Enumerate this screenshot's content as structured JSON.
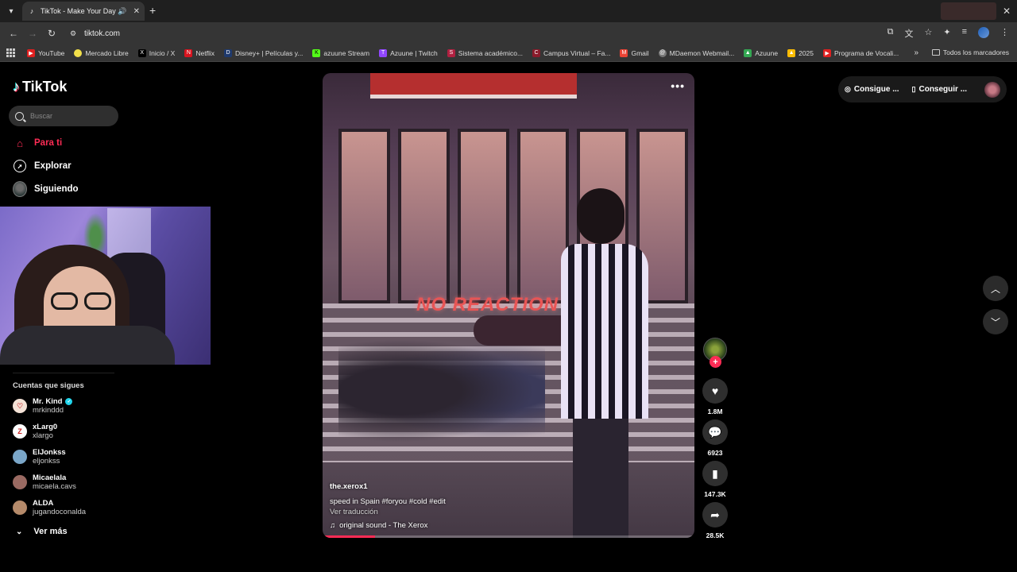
{
  "browser": {
    "tab_title": "TikTok - Make Your Day",
    "url": "tiktok.com",
    "bookmarks": [
      {
        "label": "YouTube",
        "color": "#e02020"
      },
      {
        "label": "Mercado Libre",
        "color": "#f2e04a"
      },
      {
        "label": "Inicio / X",
        "color": "#000000"
      },
      {
        "label": "Netflix",
        "color": "#d8141f"
      },
      {
        "label": "Disney+ | Películas y...",
        "color": "#1f3a6e"
      },
      {
        "label": "azuune Stream",
        "color": "#53fc18"
      },
      {
        "label": "Azuune | Twitch",
        "color": "#9146ff"
      },
      {
        "label": "Sistema académico...",
        "color": "#b02040"
      },
      {
        "label": "Campus Virtual – Fa...",
        "color": "#8a1a2a"
      },
      {
        "label": "Gmail",
        "color": "#ea4335"
      },
      {
        "label": "MDaemon Webmail...",
        "color": "#777777"
      },
      {
        "label": "Azuune",
        "color": "#34a853"
      },
      {
        "label": "2025",
        "color": "#fbbc04"
      },
      {
        "label": "Programa de Vocali...",
        "color": "#e02020"
      }
    ],
    "bookmarks_all": "Todos los marcadores"
  },
  "sidebar": {
    "logo": "TikTok",
    "search_placeholder": "Buscar",
    "nav": [
      {
        "label": "Para ti",
        "active": true
      },
      {
        "label": "Explorar"
      },
      {
        "label": "Siguiendo"
      }
    ],
    "following_title": "Cuentas que sigues",
    "accounts": [
      {
        "name": "Mr. Kind",
        "handle": "mrkinddd",
        "verified": true
      },
      {
        "name": "xLarg0",
        "handle": "xlargo"
      },
      {
        "name": "ElJonkss",
        "handle": "eljonkss"
      },
      {
        "name": "Micaelala",
        "handle": "micaela.cavs"
      },
      {
        "name": "ALDA",
        "handle": "jugandoconalda"
      }
    ],
    "see_more": "Ver más"
  },
  "header": {
    "pill1": "Consigue ...",
    "pill2": "Conseguir ..."
  },
  "video": {
    "caption_overlay": "NO REACTION",
    "username": "the.xerox1",
    "description": "speed in Spain #foryou  #cold  #edit",
    "translate": "Ver traducción",
    "sound": "original sound - The Xerox",
    "progress": 0.14
  },
  "actions": {
    "likes": "1.8M",
    "comments": "6923",
    "saves": "147.3K",
    "shares": "28.5K"
  },
  "colors": {
    "accent": "#fe2c55"
  }
}
